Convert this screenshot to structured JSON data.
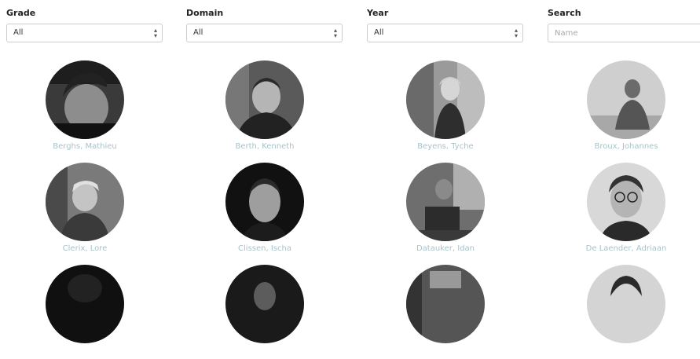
{
  "filters": {
    "grade": {
      "label": "Grade",
      "selected": "All"
    },
    "domain": {
      "label": "Domain",
      "selected": "All"
    },
    "year": {
      "label": "Year",
      "selected": "All"
    },
    "search": {
      "label": "Search",
      "placeholder": "Name",
      "value": ""
    }
  },
  "students": [
    {
      "name": "Berghs, Mathieu"
    },
    {
      "name": "Berth, Kenneth"
    },
    {
      "name": "Beyens, Tyche"
    },
    {
      "name": "Broux, Johannes"
    },
    {
      "name": "Clerix, Lore"
    },
    {
      "name": "Clissen, Ischa"
    },
    {
      "name": "Datauker, Idan"
    },
    {
      "name": "De Laender, Adriaan"
    },
    {
      "name": ""
    },
    {
      "name": ""
    },
    {
      "name": ""
    },
    {
      "name": ""
    }
  ]
}
